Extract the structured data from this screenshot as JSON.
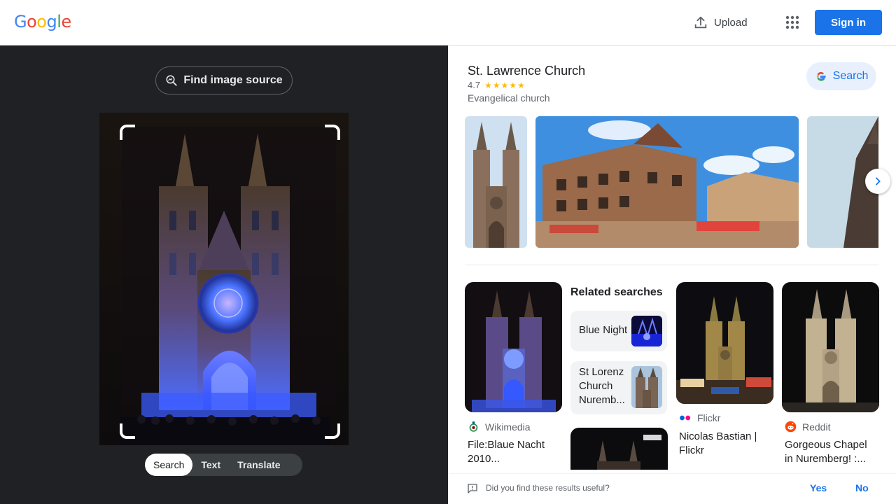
{
  "header": {
    "logo_letters": [
      {
        "ch": "G",
        "color": "#4285f4"
      },
      {
        "ch": "o",
        "color": "#ea4335"
      },
      {
        "ch": "o",
        "color": "#fbbc04"
      },
      {
        "ch": "g",
        "color": "#4285f4"
      },
      {
        "ch": "l",
        "color": "#34a853"
      },
      {
        "ch": "e",
        "color": "#ea4335"
      }
    ],
    "upload_label": "Upload",
    "apps_icon": "apps-grid-icon",
    "signin_label": "Sign in"
  },
  "lens": {
    "find_source_label": "Find image source",
    "modes": [
      "Search",
      "Text",
      "Translate"
    ],
    "active_mode": "Search"
  },
  "knowledge_panel": {
    "title": "St. Lawrence Church",
    "rating": "4.7",
    "stars": "★★★★★",
    "type": "Evangelical church",
    "search_label": "Search"
  },
  "results": [
    {
      "source": "Wikimedia",
      "title_line1": "File:Blaue Nacht",
      "title_line2": "2010..."
    },
    {
      "source": "Flickr",
      "title_line1": "Nicolas Bastian |",
      "title_line2": "Flickr"
    },
    {
      "source": "Reddit",
      "title_line1": "Gorgeous Chapel",
      "title_line2": "in Nuremberg! :..."
    }
  ],
  "related": {
    "heading": "Related searches",
    "items": [
      {
        "line1": "Blue Night",
        "line2": "",
        "line3": ""
      },
      {
        "line1": "St Lorenz",
        "line2": "Church",
        "line3": "Nuremb..."
      }
    ]
  },
  "feedback": {
    "question": "Did you find these results useful?",
    "yes": "Yes",
    "no": "No"
  },
  "colors": {
    "accent": "#1a73e8",
    "dark_pane": "#202124",
    "star": "#fbbc04"
  }
}
